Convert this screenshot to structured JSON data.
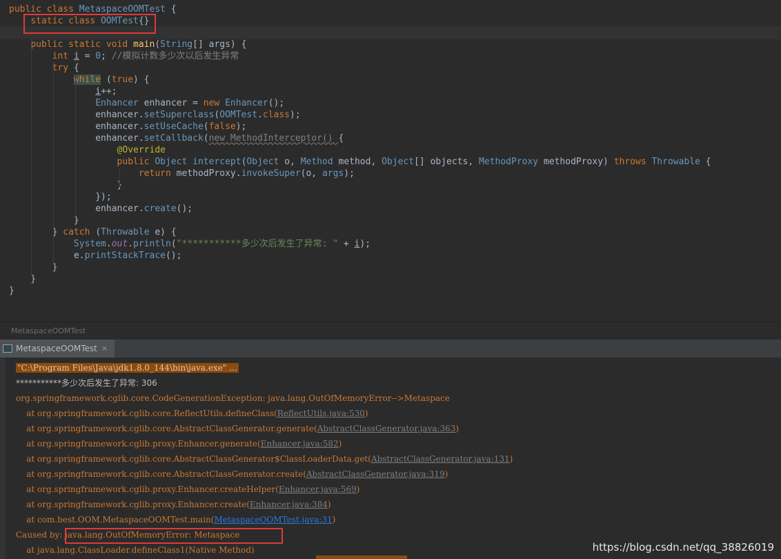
{
  "editor": {
    "lines": [
      [
        [
          "kw",
          "public class "
        ],
        [
          "cls",
          "MetaspaceOOMTest"
        ],
        [
          "plain",
          " {"
        ]
      ],
      [
        [
          "plain",
          "    "
        ],
        [
          "kw",
          "static class "
        ],
        [
          "cls",
          "OOMTest"
        ],
        [
          "plain",
          "{}"
        ]
      ],
      [
        [
          "plain",
          ""
        ]
      ],
      [
        [
          "plain",
          "    "
        ],
        [
          "kw",
          "public static void "
        ],
        [
          "fn",
          "main"
        ],
        [
          "plain",
          "("
        ],
        [
          "typ",
          "String"
        ],
        [
          "plain",
          "[] args) {"
        ]
      ],
      [
        [
          "plain",
          "        "
        ],
        [
          "kw",
          "int "
        ],
        [
          "u",
          "i"
        ],
        [
          "plain",
          " = "
        ],
        [
          "num",
          "0"
        ],
        [
          "plain",
          "; "
        ],
        [
          "cmt",
          "//模拟计数多少次以后发生异常"
        ]
      ],
      [
        [
          "plain",
          "        "
        ],
        [
          "kw",
          "try "
        ],
        [
          "plain",
          "{"
        ]
      ],
      [
        [
          "plain",
          "            "
        ],
        [
          "hl",
          "while"
        ],
        [
          "plain",
          " ("
        ],
        [
          "kw",
          "true"
        ],
        [
          "plain",
          ") {"
        ]
      ],
      [
        [
          "plain",
          "                "
        ],
        [
          "u",
          "i"
        ],
        [
          "plain",
          "++;"
        ]
      ],
      [
        [
          "plain",
          "                "
        ],
        [
          "typ",
          "Enhancer"
        ],
        [
          "plain",
          " enhancer = "
        ],
        [
          "kw",
          "new "
        ],
        [
          "typ",
          "Enhancer"
        ],
        [
          "plain",
          "();"
        ]
      ],
      [
        [
          "plain",
          "                enhancer."
        ],
        [
          "fnc",
          "setSuperclass"
        ],
        [
          "plain",
          "("
        ],
        [
          "typ",
          "OOMTest"
        ],
        [
          "plain",
          "."
        ],
        [
          "kw",
          "class"
        ],
        [
          "plain",
          ");"
        ]
      ],
      [
        [
          "plain",
          "                enhancer."
        ],
        [
          "fnc",
          "setUseCache"
        ],
        [
          "plain",
          "("
        ],
        [
          "kw",
          "false"
        ],
        [
          "plain",
          ");"
        ]
      ],
      [
        [
          "plain",
          "                enhancer."
        ],
        [
          "fnc",
          "setCallback"
        ],
        [
          "plain",
          "("
        ],
        [
          "wavy",
          "new MethodInterceptor() "
        ],
        [
          "plain",
          "{"
        ]
      ],
      [
        [
          "plain",
          "                    "
        ],
        [
          "ann",
          "@Override"
        ]
      ],
      [
        [
          "plain",
          "                    "
        ],
        [
          "kw",
          "public "
        ],
        [
          "typ",
          "Object "
        ],
        [
          "fnc",
          "intercept"
        ],
        [
          "plain",
          "("
        ],
        [
          "typ",
          "Object"
        ],
        [
          "plain",
          " o, "
        ],
        [
          "typ",
          "Method"
        ],
        [
          "plain",
          " method, "
        ],
        [
          "typ",
          "Object"
        ],
        [
          "plain",
          "[] objects, "
        ],
        [
          "typ",
          "MethodProxy"
        ],
        [
          "plain",
          " methodProxy) "
        ],
        [
          "kw",
          "throws "
        ],
        [
          "typ",
          "Throwable"
        ],
        [
          "plain",
          " {"
        ]
      ],
      [
        [
          "plain",
          "                        "
        ],
        [
          "kw",
          "return "
        ],
        [
          "plain",
          "methodProxy."
        ],
        [
          "fnc",
          "invokeSuper"
        ],
        [
          "plain",
          "(o, "
        ],
        [
          "typ",
          "args"
        ],
        [
          "plain",
          ");"
        ]
      ],
      [
        [
          "plain",
          "                    }"
        ]
      ],
      [
        [
          "plain",
          "                });"
        ]
      ],
      [
        [
          "plain",
          "                enhancer."
        ],
        [
          "fnc",
          "create"
        ],
        [
          "plain",
          "();"
        ]
      ],
      [
        [
          "plain",
          "            }"
        ]
      ],
      [
        [
          "plain",
          "        } "
        ],
        [
          "kw",
          "catch "
        ],
        [
          "plain",
          "("
        ],
        [
          "typ",
          "Throwable"
        ],
        [
          "plain",
          " e) {"
        ]
      ],
      [
        [
          "plain",
          "            "
        ],
        [
          "typ",
          "System"
        ],
        [
          "plain",
          "."
        ],
        [
          "field",
          "out"
        ],
        [
          "plain",
          "."
        ],
        [
          "fnc",
          "println"
        ],
        [
          "plain",
          "("
        ],
        [
          "str",
          "\"***********多少次后发生了异常: \""
        ],
        [
          "plain",
          " + "
        ],
        [
          "u",
          "i"
        ],
        [
          "plain",
          ");"
        ]
      ],
      [
        [
          "plain",
          "            e."
        ],
        [
          "fnc",
          "printStackTrace"
        ],
        [
          "plain",
          "();"
        ]
      ],
      [
        [
          "plain",
          "        }"
        ]
      ],
      [
        [
          "plain",
          "    }"
        ]
      ],
      [
        [
          "plain",
          "}"
        ]
      ]
    ]
  },
  "breadcrumb": "MetaspaceOOMTest",
  "run_tab": {
    "label": "MetaspaceOOMTest",
    "close": "×"
  },
  "console": {
    "lines": [
      {
        "kind": "cmd",
        "text": "\"C:\\Program Files\\Java\\jdk1.8.0_144\\bin\\java.exe\" ..."
      },
      {
        "kind": "stars",
        "text": "***********多少次后发生了异常: 306"
      },
      {
        "kind": "err",
        "text": "org.springframework.cglib.core.CodeGenerationException: java.lang.OutOfMemoryError-->Metaspace"
      },
      {
        "kind": "at",
        "text": "    at org.springframework.cglib.core.ReflectUtils.defineClass(",
        "link": "ReflectUtils.java:530",
        "tail": ")"
      },
      {
        "kind": "at",
        "text": "    at org.springframework.cglib.core.AbstractClassGenerator.generate(",
        "link": "AbstractClassGenerator.java:363",
        "tail": ")"
      },
      {
        "kind": "at",
        "text": "    at org.springframework.cglib.proxy.Enhancer.generate(",
        "link": "Enhancer.java:582",
        "tail": ")"
      },
      {
        "kind": "at",
        "text": "    at org.springframework.cglib.core.AbstractClassGenerator$ClassLoaderData.get(",
        "link": "AbstractClassGenerator.java:131",
        "tail": ")"
      },
      {
        "kind": "at",
        "text": "    at org.springframework.cglib.core.AbstractClassGenerator.create(",
        "link": "AbstractClassGenerator.java:319",
        "tail": ")"
      },
      {
        "kind": "at",
        "text": "    at org.springframework.cglib.proxy.Enhancer.createHelper(",
        "link": "Enhancer.java:569",
        "tail": ")"
      },
      {
        "kind": "at",
        "text": "    at org.springframework.cglib.proxy.Enhancer.create(",
        "link": "Enhancer.java:384",
        "tail": ")"
      },
      {
        "kind": "at-blue",
        "text": "    at com.best.OOM.MetaspaceOOMTest.main(",
        "link": "MetaspaceOOMTest.java:31",
        "tail": ")"
      },
      {
        "kind": "err",
        "text": "Caused by: java.lang.OutOfMemoryError: Metaspace"
      },
      {
        "kind": "err",
        "text": "    at java.lang.ClassLoader.defineClass1(Native Method)"
      }
    ]
  },
  "caused_by": "java.lang.OutOfMemoryError: Metaspace",
  "watermark": "https://blog.csdn.net/qq_38826019",
  "colors": {
    "keyword": "#cc7832",
    "class": "#6897bb",
    "annotation": "#bbb529",
    "highlight_box": "#e03a3a",
    "cmd_bg": "#8a4b0f"
  }
}
